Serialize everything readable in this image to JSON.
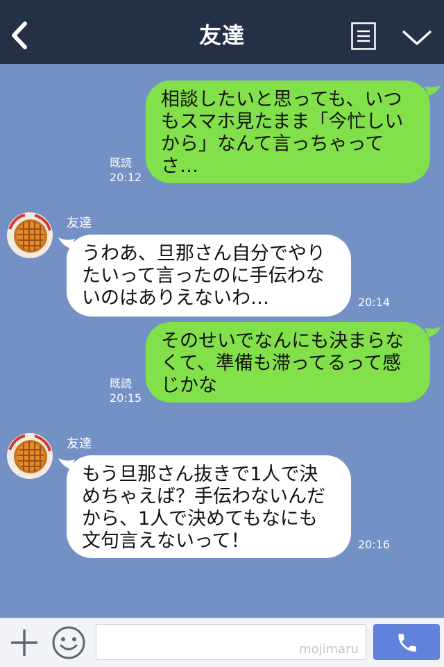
{
  "header": {
    "title": "友達",
    "icons": [
      "back-icon",
      "memo-icon",
      "chevron-down-icon"
    ]
  },
  "messages": [
    {
      "side": "out",
      "text": "相談したいと思っても、いつもスマホ見たまま「今忙しいから」なんて言っちゃってさ…",
      "read_label": "既読",
      "time": "20:12"
    },
    {
      "side": "in",
      "sender": "友達",
      "text": "うわあ、旦那さん自分でやりたいって言ったのに手伝わないのはありえないわ…",
      "time": "20:14"
    },
    {
      "side": "out",
      "text": "そのせいでなんにも決まらなくて、準備も滞ってるって感じかな",
      "read_label": "既読",
      "time": "20:15"
    },
    {
      "side": "in",
      "sender": "友達",
      "text": "もう旦那さん抜きで1人で決めちゃえば？手伝わないんだから、1人で決めてもなにも文句言えないって！",
      "time": "20:16"
    }
  ],
  "input_bar": {
    "placeholder": "",
    "watermark": "mojimaru",
    "icons": [
      "plus-icon",
      "smile-icon",
      "phone-icon"
    ]
  },
  "colors": {
    "background": "#7391c5",
    "header": "#243046",
    "outgoing_bubble": "#82e04b",
    "incoming_bubble": "#ffffff",
    "call_button": "#6181dc"
  }
}
